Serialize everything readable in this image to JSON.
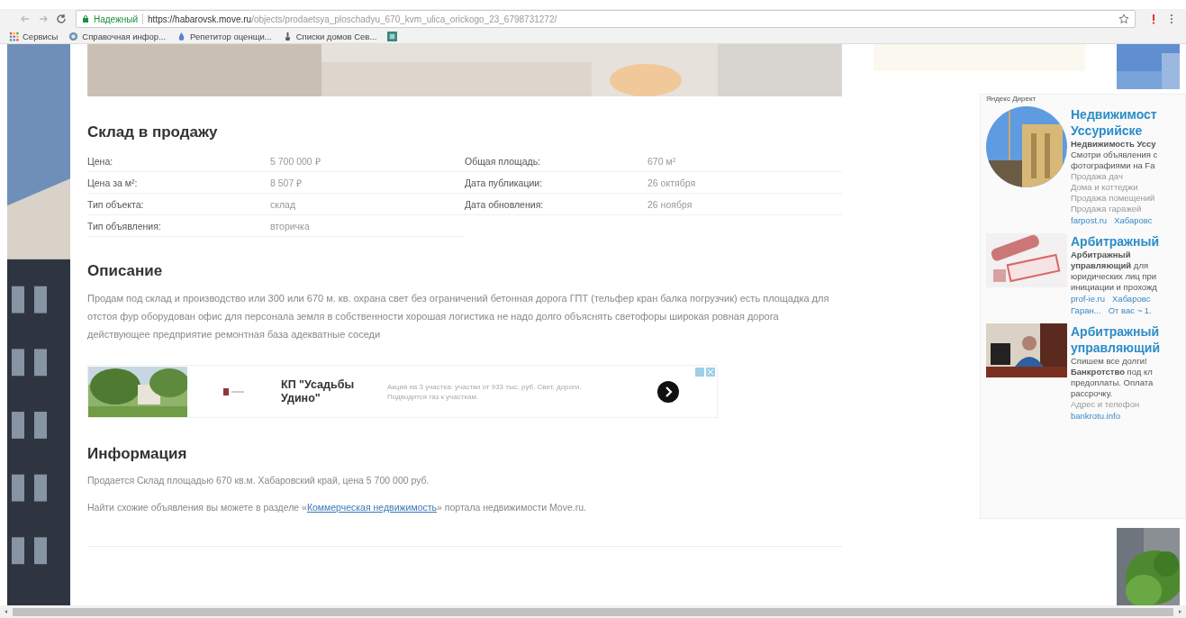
{
  "browser": {
    "security_label": "Надежный",
    "url_host": "https://habarovsk.move.ru",
    "url_path": "/objects/prodaetsya_ploschadyu_670_kvm_ulica_orickogo_23_6798731272/",
    "bookmarks": [
      {
        "label": "Сервисы",
        "kind": "apps"
      },
      {
        "label": "Справочная инфор...",
        "kind": "globe"
      },
      {
        "label": "Репетитор оценщи...",
        "kind": "drop"
      },
      {
        "label": "Списки домов Сев...",
        "kind": "pin"
      },
      {
        "kind": "tile"
      }
    ]
  },
  "listing": {
    "title": "Склад в продажу",
    "params_left": [
      {
        "label": "Цена:",
        "value": "5 700 000 ₽"
      },
      {
        "label": "Цена за м²:",
        "value": "8 507 ₽"
      },
      {
        "label": "Тип объекта:",
        "value": "склад"
      },
      {
        "label": "Тип объявления:",
        "value": "вторичка"
      }
    ],
    "params_right": [
      {
        "label": "Общая площадь:",
        "value": "670 м²"
      },
      {
        "label": "Дата публикации:",
        "value": "26 октября"
      },
      {
        "label": "Дата обновления:",
        "value": "26 ноября"
      }
    ]
  },
  "description": {
    "title": "Описание",
    "text": "Продам под склад и производство или 300 или 670 м. кв. охрана свет без ограничений бетонная дорога ГПТ (тельфер кран балка погрузчик) есть площадка для отстоя фур оборудован офис для персонала земля в собственности хорошая логистика не надо долго объяснять светофоры широкая ровная дорога действующее предприятие ремонтная база адекватные соседи"
  },
  "ad": {
    "title": "КП \"Усадьбы Удино\"",
    "text": "Акция на 3 участка: участки от 933 тыс. руб. Свет, дороги. Подводится газ к участкам."
  },
  "information": {
    "title": "Информация",
    "text": "Продается Склад площадью 670 кв.м. Хабаровский край, цена 5 700 000 руб.",
    "find_prefix": "Найти схожие объявления вы можете в разделе «",
    "find_link": "Коммерческая недвижимость",
    "find_suffix": "» портала недвижимости Move.ru."
  },
  "direct": {
    "label": "Яндекс Директ",
    "items": [
      {
        "title_lines": [
          "Недвижимост",
          "Уссурийске"
        ],
        "text_lines": [
          "**Недвижимость Уссу**",
          "Смотри объявления с",
          "фотографиями на Fa"
        ],
        "links": [
          "Продажа дач",
          "Дома и коттеджи",
          "Продажа помещений",
          "Продажа гаражей"
        ],
        "footer": [
          "farpost.ru",
          "Хабаровс"
        ]
      },
      {
        "title_lines": [
          "Арбитражный"
        ],
        "text_lines": [
          "**Арбитражный**",
          "**управляющий** для",
          "юридических лиц при",
          "инициации и прохожд"
        ],
        "footer": [
          "prof-ie.ru",
          "Хабаровс"
        ],
        "footer2": [
          "Гаран...",
          "От вас ~ 1."
        ]
      },
      {
        "title_lines": [
          "Арбитражный",
          "управляющий"
        ],
        "text_lines": [
          "Спишем все долги!",
          "**Банкротство** под кл",
          "предоплаты. Оплата",
          "рассрочку."
        ],
        "links": [
          "Адрес и телефон"
        ],
        "footer": [
          "bankrotu.info"
        ]
      }
    ]
  }
}
